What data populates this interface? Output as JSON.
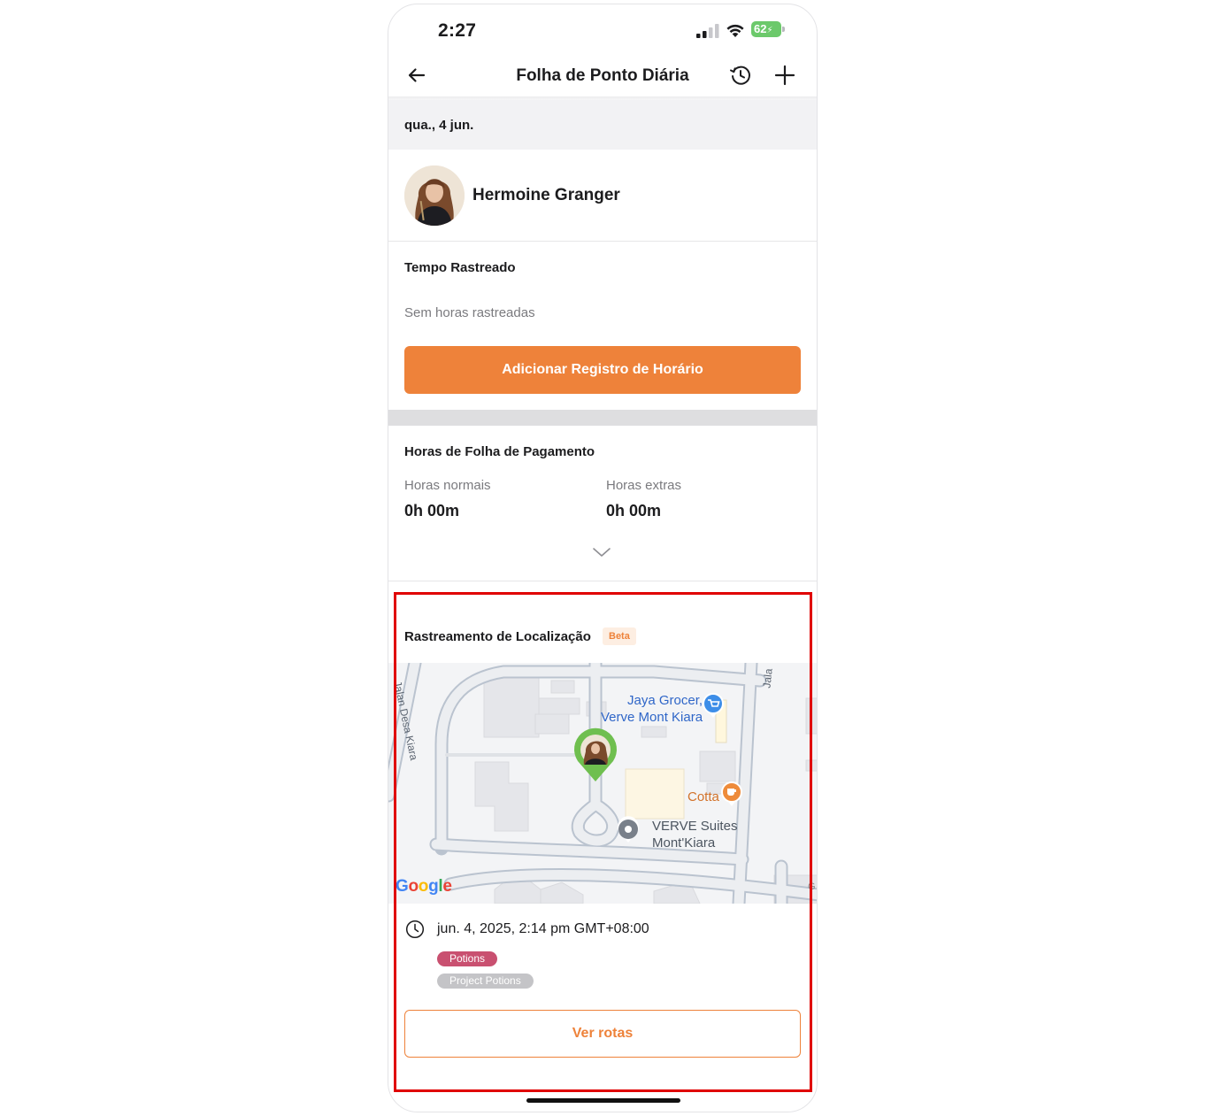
{
  "status_bar": {
    "time": "2:27",
    "battery": "62"
  },
  "nav": {
    "title": "Folha de Ponto Diária",
    "icons": [
      "arrow-left-icon",
      "history-icon",
      "plus-icon"
    ]
  },
  "date": "qua., 4 jun.",
  "employee": {
    "name": "Hermoine Granger"
  },
  "tracked_time": {
    "title": "Tempo Rastreado",
    "empty_text": "Sem horas rastreadas",
    "add_button": "Adicionar Registro de Horário"
  },
  "payroll": {
    "title": "Horas de Folha de Pagamento",
    "regular_label": "Horas normais",
    "regular_value": "0h 00m",
    "overtime_label": "Horas extras",
    "overtime_value": "0h 00m"
  },
  "location": {
    "title": "Rastreamento de Localização",
    "badge": "Beta",
    "map": {
      "places": [
        {
          "line1": "Jaya Grocer,",
          "line2": "Verve Mont Kiara"
        },
        {
          "line1": "Cotta",
          "line2": ""
        },
        {
          "line1": "VERVE Suites",
          "line2": "Mont'Kiara"
        }
      ],
      "street_left": "Jalan Desa Kiara",
      "street_right": "Jala",
      "attribution": [
        "G",
        "o",
        "o",
        "g",
        "l",
        "e"
      ],
      "edge_letter": "G"
    },
    "entry": {
      "timestamp": "jun. 4, 2025, 2:14 pm GMT+08:00",
      "tags": [
        "Potions",
        "Project Potions"
      ]
    },
    "routes_button": "Ver rotas"
  },
  "colors": {
    "accent": "#ee823a",
    "tag_pink": "#c95070",
    "tag_gray": "#c4c4c7",
    "pin_green": "#6fbf4f",
    "highlight": "#e00000"
  }
}
